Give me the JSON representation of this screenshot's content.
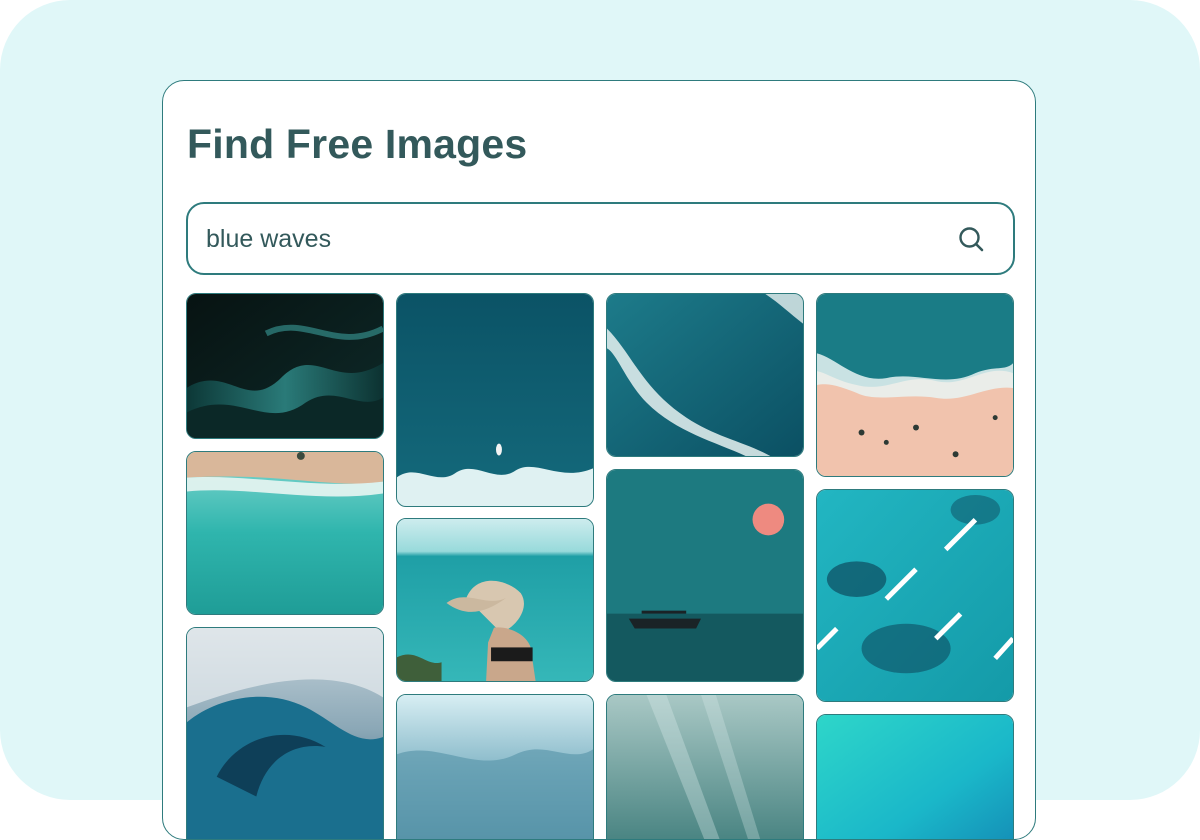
{
  "page": {
    "title": "Find Free Images"
  },
  "search": {
    "value": "blue waves",
    "icon": "search-icon"
  },
  "results": [
    {
      "name": "image-dark-abstract-waves"
    },
    {
      "name": "image-ocean-aerial-surfer"
    },
    {
      "name": "image-aerial-breaking-waves"
    },
    {
      "name": "image-beach-aerial-people"
    },
    {
      "name": "image-turquoise-beach-aerial"
    },
    {
      "name": "image-woman-hair-blowing-sea"
    },
    {
      "name": "image-sunset-boat-sea"
    },
    {
      "name": "image-boats-reef-aerial"
    },
    {
      "name": "image-crashing-wave-spray"
    },
    {
      "name": "image-misty-water"
    },
    {
      "name": "image-underwater-light-rays"
    },
    {
      "name": "image-bright-turquoise-water"
    }
  ],
  "colors": {
    "accent": "#2e7b7d",
    "title": "#33595b",
    "backdrop": "#e0f7f8"
  }
}
